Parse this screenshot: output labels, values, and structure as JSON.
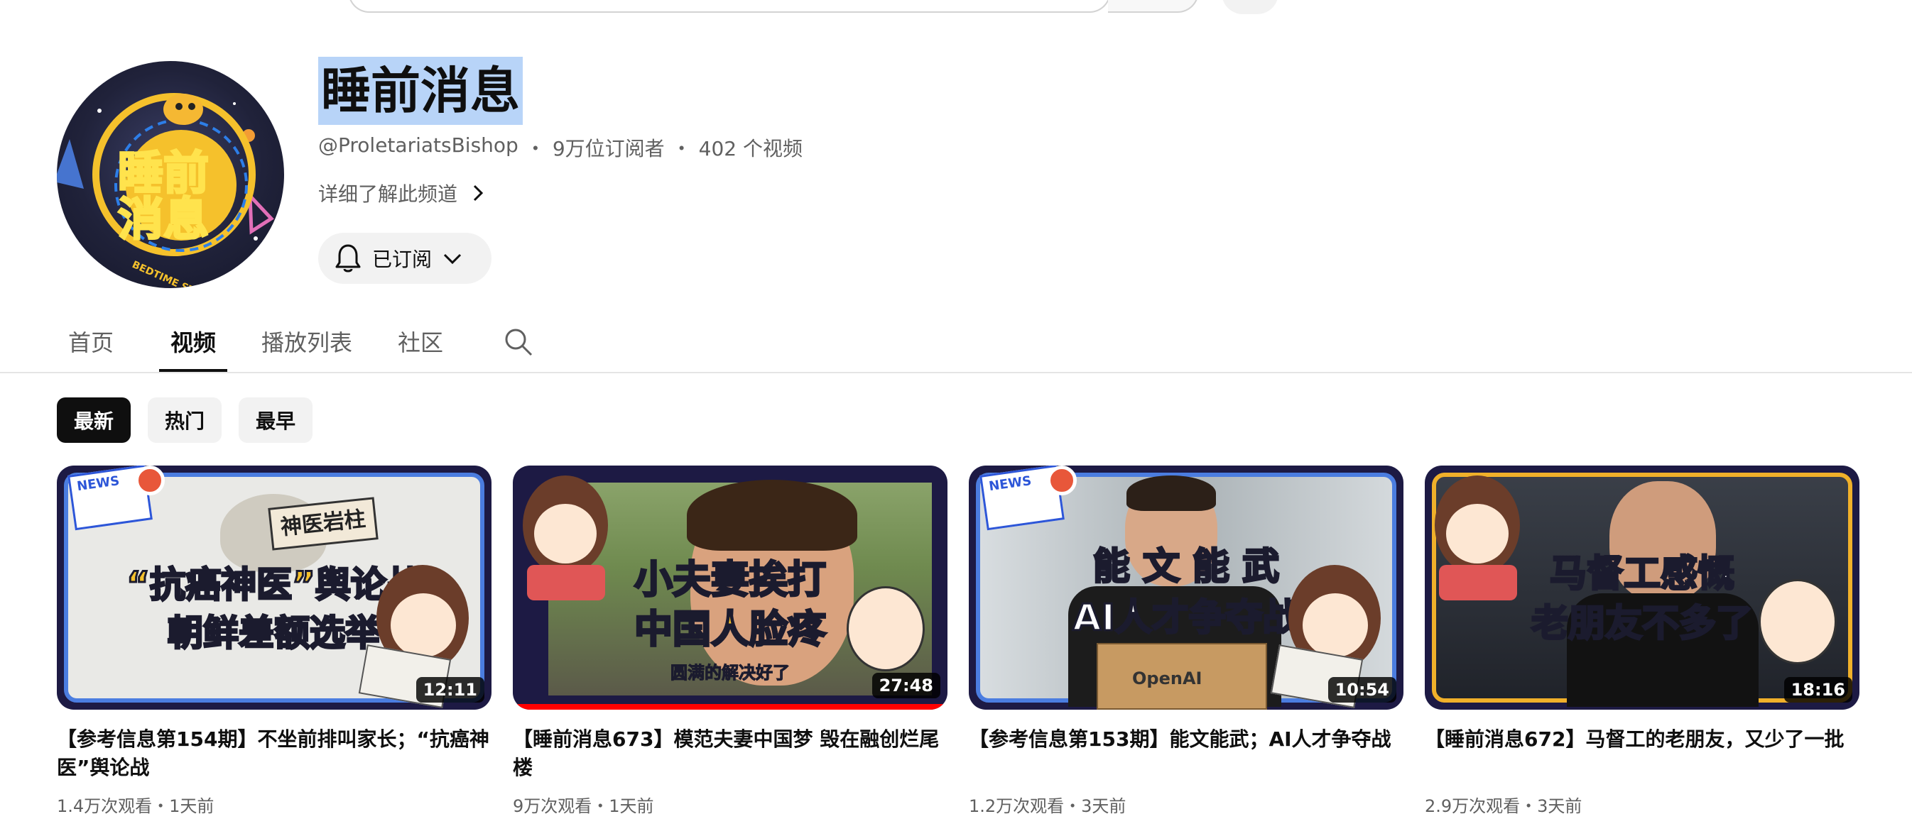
{
  "channel": {
    "name": "睡前消息",
    "handle": "@ProletariatsBishop",
    "subscribers": "9万位订阅者",
    "video_count": "402 个视频",
    "separator": "・",
    "about_link": "详细了解此频道",
    "subscribe_label": "已订阅",
    "avatar_text_1": "睡前",
    "avatar_text_2": "消息",
    "avatar_ring_text": "BEDTIME STORY"
  },
  "tabs": [
    {
      "label": "首页"
    },
    {
      "label": "视频"
    },
    {
      "label": "播放列表"
    },
    {
      "label": "社区"
    }
  ],
  "chips": [
    {
      "label": "最新"
    },
    {
      "label": "热门"
    },
    {
      "label": "最早"
    }
  ],
  "videos": [
    {
      "title": "【参考信息第154期】不坐前排叫家长；“抗癌神医”舆论战",
      "meta": "1.4万次观看・1天前",
      "duration": "12:11",
      "thumb_line1": "“抗癌神医”舆论战",
      "thumb_line2": "朝鲜差额选举",
      "thumb_sign": "神医岩柱",
      "thumb_badge": "NEWS"
    },
    {
      "title": "【睡前消息673】模范夫妻中国梦 毁在融创烂尾楼",
      "meta": "9万次观看・1天前",
      "duration": "27:48",
      "thumb_line1": "小夫妻挨打",
      "thumb_line2": "中国人脸疼",
      "thumb_caption": "圆满的解决好了",
      "progress_percent": 100
    },
    {
      "title": "【参考信息第153期】能文能武；AI人才争夺战",
      "meta": "1.2万次观看・3天前",
      "duration": "10:54",
      "thumb_line1": "能 文 能 武",
      "thumb_line2": "AI人才争夺战",
      "thumb_box_label": "OpenAI",
      "thumb_badge": "NEWS"
    },
    {
      "title": "【睡前消息672】马督工的老朋友，又少了一批",
      "meta": "2.9万次观看・3天前",
      "duration": "18:16",
      "thumb_line1": "马督工感慨",
      "thumb_line2": "老朋友不多了"
    }
  ]
}
